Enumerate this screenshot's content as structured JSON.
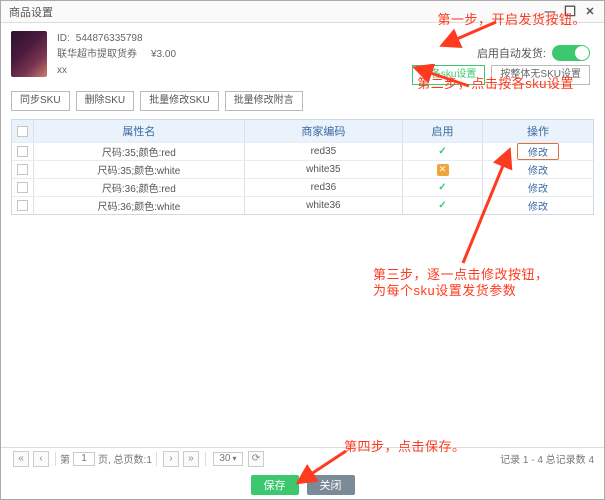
{
  "window": {
    "title": "商品设置"
  },
  "product": {
    "id_label": "ID:",
    "id": "544876335798",
    "name": "联华超市提取货券",
    "price": "¥3.00",
    "extra": "xx"
  },
  "auto_ship": {
    "label": "启用自动发货:"
  },
  "mode_buttons": {
    "by_sku": "按各sku设置",
    "whole": "按整体无SKU设置"
  },
  "toolbar": {
    "sync": "同步SKU",
    "del": "删除SKU",
    "batch_edit": "批量修改SKU",
    "batch_note": "批量修改附言"
  },
  "columns": {
    "attr": "属性名",
    "code": "商家编码",
    "enabled": "启用",
    "op": "操作"
  },
  "rows": [
    {
      "attr": "尺码:35;颜色:red",
      "code": "red35",
      "enabled": true,
      "op": "修改"
    },
    {
      "attr": "尺码:35;颜色:white",
      "code": "white35",
      "enabled": false,
      "op": "修改"
    },
    {
      "attr": "尺码:36;颜色:red",
      "code": "red36",
      "enabled": true,
      "op": "修改"
    },
    {
      "attr": "尺码:36;颜色:white",
      "code": "white36",
      "enabled": true,
      "op": "修改"
    }
  ],
  "footer": {
    "page_prefix": "第",
    "page_val": "1",
    "page_suffix": "页, 总页数:1",
    "size": "30",
    "record": "记录 1 - 4 总记录数 4"
  },
  "actions": {
    "save": "保存",
    "close": "关闭"
  },
  "annotations": {
    "step1": "第一步，开启发货按钮。",
    "step2": "第二步，点击按各sku设置",
    "step3a": "第三步，逐一点击修改按钮，",
    "step3b": "为每个sku设置发货参数",
    "step4": "第四步，点击保存。"
  }
}
